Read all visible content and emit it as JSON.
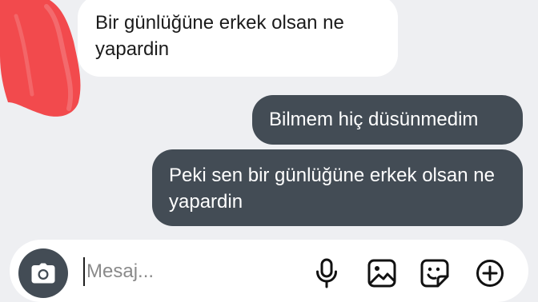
{
  "messages": [
    {
      "direction": "incoming",
      "text": "Bir günlüğüne erkek olsan ne yapardin"
    },
    {
      "direction": "outgoing",
      "text": "Bilmem hiç düsünmedim"
    },
    {
      "direction": "outgoing",
      "text": "Peki sen bir günlüğüne erkek olsan ne yapardin"
    }
  ],
  "composer": {
    "placeholder": "Mesaj...",
    "value": ""
  },
  "icons": {
    "camera": "camera-icon",
    "microphone": "microphone-icon",
    "gallery": "gallery-icon",
    "sticker": "sticker-icon",
    "add": "add-circle-icon"
  },
  "colors": {
    "background": "#eeeff2",
    "incoming_bubble": "#ffffff",
    "outgoing_bubble": "#434c55",
    "redaction": "#f24a4d"
  }
}
